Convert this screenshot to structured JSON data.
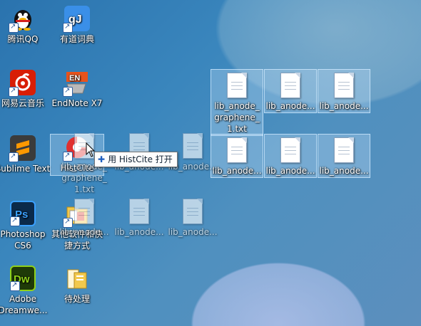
{
  "desktop_icons": [
    {
      "label": "腾讯QQ"
    },
    {
      "label": "有道词典"
    },
    {
      "label": "网易云音乐"
    },
    {
      "label": "EndNote X7"
    },
    {
      "label": "Sublime Text"
    },
    {
      "label": "HistCite"
    },
    {
      "label": "Photoshop CS6"
    },
    {
      "label": "其他软件和快捷方式"
    },
    {
      "label": "Adobe Dreamwe..."
    },
    {
      "label": "待处理"
    }
  ],
  "files_selected": [
    {
      "label": "lib_anode_graphene_1.txt"
    },
    {
      "label": "lib_anode..."
    },
    {
      "label": "lib_anode..."
    },
    {
      "label": "lib_anode..."
    },
    {
      "label": "lib_anode..."
    },
    {
      "label": "lib_anode..."
    }
  ],
  "files_dragging": [
    {
      "label": "lib_anode_graphene_1.txt"
    },
    {
      "label": "lib_anode..."
    },
    {
      "label": "lib_anode..."
    },
    {
      "label": "lib_anode..."
    },
    {
      "label": "lib_anode..."
    },
    {
      "label": "lib_anode..."
    }
  ],
  "drag_tooltip": {
    "text": "用 HistCite 打开"
  },
  "icons": {
    "qq": "qq-penguin-icon",
    "youdao": "youdao-dict-icon",
    "netease": "netease-music-icon",
    "endnote": "endnote-icon",
    "sublime": "sublime-text-icon",
    "histcite": "histcite-icon",
    "photoshop": "photoshop-icon",
    "folder": "folder-icon",
    "dreamweaver": "dreamweaver-icon",
    "text_file": "text-file-icon"
  }
}
